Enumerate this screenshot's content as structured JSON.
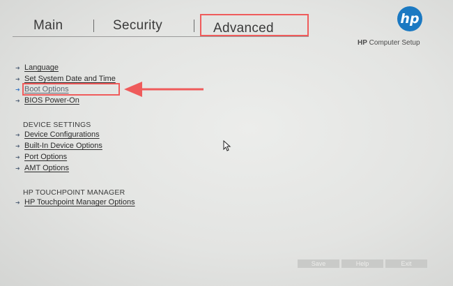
{
  "tabs": [
    {
      "label": "Main"
    },
    {
      "label": "Security"
    },
    {
      "label": "Advanced"
    }
  ],
  "header": {
    "logo_text": "hp",
    "brand_bold": "HP",
    "brand_rest": " Computer Setup"
  },
  "menu": {
    "items_top": [
      "Language",
      "Set System Date and Time",
      "Boot Options",
      "BIOS Power-On"
    ],
    "device_title": "DEVICE SETTINGS",
    "items_device": [
      "Device Configurations",
      "Built-In Device Options",
      "Port Options",
      "AMT Options"
    ],
    "touchpoint_title": "HP TOUCHPOINT MANAGER",
    "items_touchpoint": [
      "HP Touchpoint Manager Options"
    ]
  },
  "footer": {
    "save": "Save",
    "help": "Help",
    "exit": "Exit"
  },
  "colors": {
    "highlight": "#ef5b5b",
    "logo": "#1b79c2"
  },
  "icons": [
    "hp-logo",
    "menu-arrow-icon",
    "annotation-arrow-icon",
    "mouse-pointer-icon"
  ]
}
